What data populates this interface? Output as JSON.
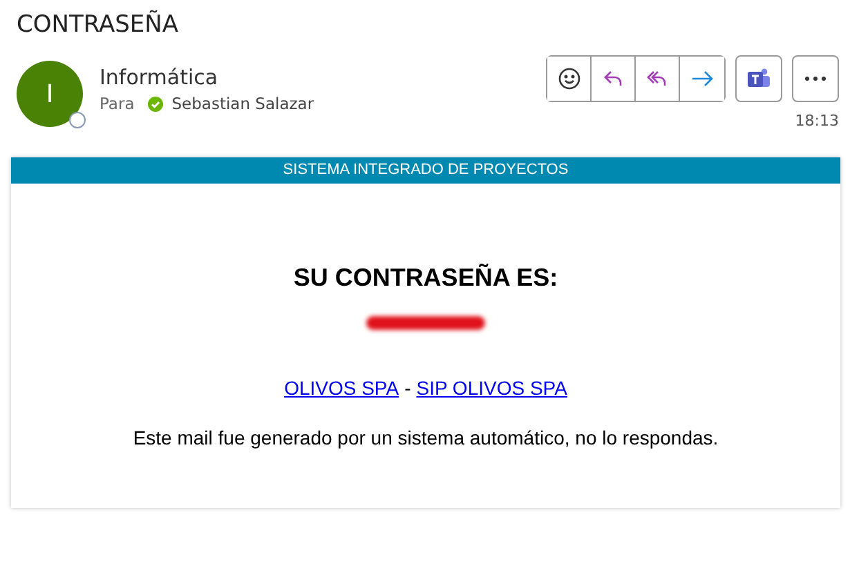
{
  "subject": "CONTRASEÑA",
  "sender": {
    "initial": "I",
    "name": "Informática",
    "to_label": "Para",
    "recipient": "Sebastian Salazar"
  },
  "time": "18:13",
  "email": {
    "banner": "SISTEMA INTEGRADO DE PROYECTOS",
    "heading": "SU CONTRASEÑA ES:",
    "links": [
      {
        "text": "OLIVOS SPA"
      },
      {
        "text": "SIP OLIVOS SPA"
      }
    ],
    "separator": "-",
    "footer": "Este mail fue generado por un sistema automático, no lo respondas."
  }
}
